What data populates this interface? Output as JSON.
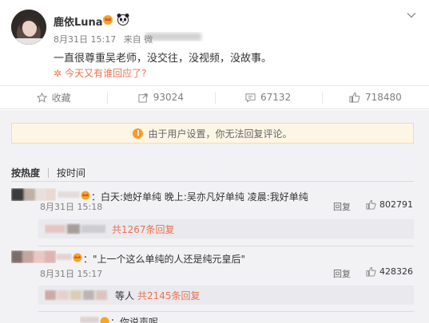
{
  "post": {
    "author": "鹿依Luna",
    "date": "8月31日 15:17",
    "source_prefix": "来自 微",
    "text": "一直很尊重吴老师，没交往，没视频，没故事。",
    "topic_icon": "spark-icon",
    "topic": "今天又有谁回应了?"
  },
  "actions": [
    {
      "icon": "star-icon",
      "label": "收藏"
    },
    {
      "icon": "share-icon",
      "label": "93024"
    },
    {
      "icon": "comment-icon",
      "label": "67132"
    },
    {
      "icon": "thumb-up-icon",
      "label": "718480"
    }
  ],
  "notice": {
    "text": "由于用户设置，你无法回复评论。",
    "icon": "warning-icon"
  },
  "sort": {
    "hot": "按热度",
    "time": "按时间"
  },
  "comments": [
    {
      "text": "：白天:她好单纯 晚上:吴亦凡好单纯 凌晨:我好单纯",
      "time": "8月31日 15:18",
      "reply": "回复",
      "likes": "802791",
      "replies": "共1267条回复"
    },
    {
      "text": "：\"上一个这么单纯的人还是纯元皇后\"",
      "time": "8月31日 15:17",
      "reply": "回复",
      "likes": "428326",
      "replies_prefix": "等人",
      "replies": "共2145条回复"
    },
    {
      "text": "：你说声呢"
    }
  ],
  "colors": {
    "accent": "#eb7350",
    "notice_bg": "#fef6e5",
    "page_bg": "#f2f2f5"
  }
}
